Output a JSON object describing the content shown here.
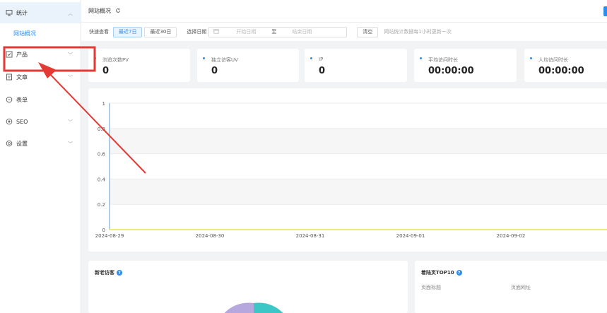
{
  "sidebar": {
    "items": [
      {
        "label": "统计",
        "icon": "monitor-icon"
      },
      {
        "label": "产品",
        "icon": "checkbox-icon"
      },
      {
        "label": "文章",
        "icon": "document-icon"
      },
      {
        "label": "表单",
        "icon": "circle-icon"
      },
      {
        "label": "SEO",
        "icon": "radio-icon"
      },
      {
        "label": "设置",
        "icon": "gear-icon"
      }
    ],
    "active_sub": "网站概况"
  },
  "header": {
    "title": "网站概况"
  },
  "filter": {
    "quick_label": "快速查看",
    "btn_7": "最近7日",
    "btn_30": "最近30日",
    "date_label": "选择日期",
    "start_placeholder": "开始日期",
    "to": "至",
    "end_placeholder": "结束日期",
    "clear": "清空",
    "hint": "网站统计数据每1小时更新一次"
  },
  "stats": [
    {
      "label": "浏览次数PV",
      "value": "0"
    },
    {
      "label": "独立访客UV",
      "value": "0"
    },
    {
      "label": "IP",
      "value": "0"
    },
    {
      "label": "平均访问时长",
      "value": "00:00:00"
    },
    {
      "label": "人均访问时长",
      "value": "00:00:00"
    }
  ],
  "chart_data": {
    "type": "line",
    "x": [
      "2024-08-29",
      "2024-08-30",
      "2024-08-31",
      "2024-09-01",
      "2024-09-02"
    ],
    "y_ticks": [
      "0",
      "0.2",
      "0.4",
      "0.6",
      "0.8",
      "1"
    ],
    "ylim": [
      0,
      1
    ],
    "series": [
      {
        "values": [
          0,
          0,
          0,
          0,
          0
        ],
        "color": "#e8e34a"
      }
    ]
  },
  "panels": {
    "visitors_title": "新老访客",
    "top10_title": "着陆页TOP10",
    "col_page_title": "页面标题",
    "col_page_url": "页面网址"
  },
  "colors": {
    "accent": "#2d8cf0",
    "annotation": "#e53935"
  }
}
